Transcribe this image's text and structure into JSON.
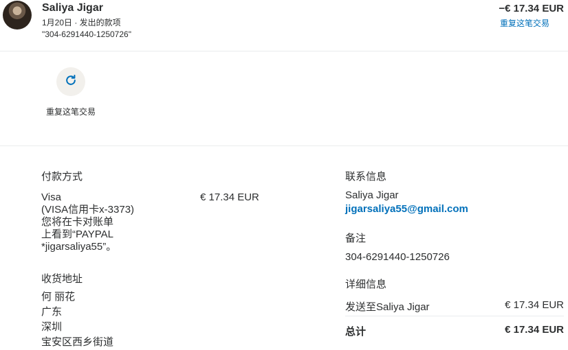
{
  "header": {
    "name": "Saliya Jigar",
    "subtitle": "1月20日 · 发出的款项",
    "reference": "\"304-6291440-1250726\"",
    "amount": "−€ 17.34 EUR",
    "repeat_link": "重复这笔交易"
  },
  "actions": {
    "repeat_label": "重复这笔交易",
    "icon": "refresh-icon"
  },
  "payment": {
    "title": "付款方式",
    "lines": [
      "Visa",
      "(VISA信用卡x-3373)",
      "您将在卡对账单",
      "上看到“PAYPAL",
      "*jigarsaliya55”。"
    ],
    "amount": "€ 17.34 EUR"
  },
  "shipping": {
    "title": "收货地址",
    "lines": [
      "何 丽花",
      "广东",
      "深圳",
      "宝安区西乡街道"
    ]
  },
  "contact": {
    "title": "联系信息",
    "name": "Saliya Jigar",
    "email": "jigarsaliya55@gmail.com"
  },
  "note": {
    "title": "备注",
    "value": "304-6291440-1250726"
  },
  "details": {
    "title": "详细信息",
    "sent_to_label": "发送至Saliya Jigar",
    "sent_to_amount": "€ 17.34 EUR",
    "total_label": "总计",
    "total_amount": "€ 17.34 EUR"
  },
  "colors": {
    "accent": "#0070ba",
    "text": "#2c2e2f",
    "divider": "#eaeced",
    "button_bg": "#f2f0ec"
  }
}
